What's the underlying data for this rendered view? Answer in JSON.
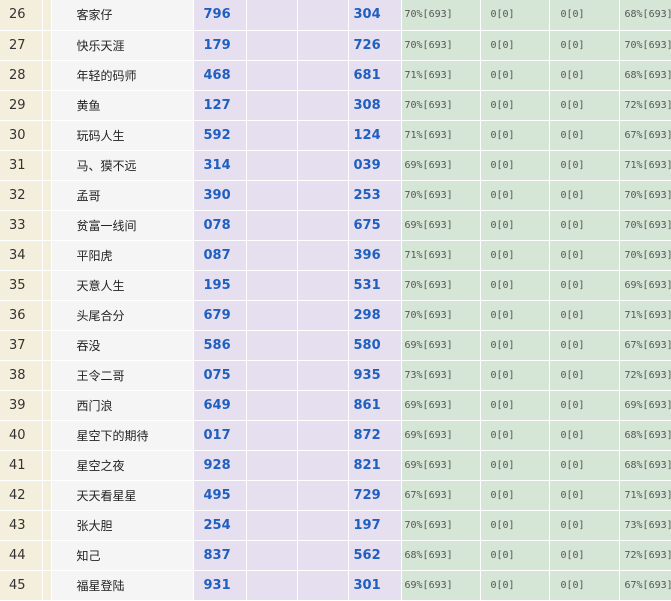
{
  "rows": [
    {
      "rank": "26",
      "name": "客家仔",
      "n1": "796",
      "n2": "304",
      "s1": "70%[693]",
      "s2": "0[0]",
      "s3": "0[0]",
      "s4": "68%[693]"
    },
    {
      "rank": "27",
      "name": "快乐天涯",
      "n1": "179",
      "n2": "726",
      "s1": "70%[693]",
      "s2": "0[0]",
      "s3": "0[0]",
      "s4": "70%[693]"
    },
    {
      "rank": "28",
      "name": "年轻的码师",
      "n1": "468",
      "n2": "681",
      "s1": "71%[693]",
      "s2": "0[0]",
      "s3": "0[0]",
      "s4": "68%[693]"
    },
    {
      "rank": "29",
      "name": "黄鱼",
      "n1": "127",
      "n2": "308",
      "s1": "70%[693]",
      "s2": "0[0]",
      "s3": "0[0]",
      "s4": "72%[693]"
    },
    {
      "rank": "30",
      "name": "玩码人生",
      "n1": "592",
      "n2": "124",
      "s1": "71%[693]",
      "s2": "0[0]",
      "s3": "0[0]",
      "s4": "67%[693]"
    },
    {
      "rank": "31",
      "name": "马、獏不远",
      "n1": "314",
      "n2": "039",
      "s1": "69%[693]",
      "s2": "0[0]",
      "s3": "0[0]",
      "s4": "71%[693]"
    },
    {
      "rank": "32",
      "name": "孟哥",
      "n1": "390",
      "n2": "253",
      "s1": "70%[693]",
      "s2": "0[0]",
      "s3": "0[0]",
      "s4": "70%[693]"
    },
    {
      "rank": "33",
      "name": "贫富一线间",
      "n1": "078",
      "n2": "675",
      "s1": "69%[693]",
      "s2": "0[0]",
      "s3": "0[0]",
      "s4": "70%[693]"
    },
    {
      "rank": "34",
      "name": "平阳虎",
      "n1": "087",
      "n2": "396",
      "s1": "71%[693]",
      "s2": "0[0]",
      "s3": "0[0]",
      "s4": "70%[693]"
    },
    {
      "rank": "35",
      "name": "天意人生",
      "n1": "195",
      "n2": "531",
      "s1": "70%[693]",
      "s2": "0[0]",
      "s3": "0[0]",
      "s4": "69%[693]"
    },
    {
      "rank": "36",
      "name": "头尾合分",
      "n1": "679",
      "n2": "298",
      "s1": "70%[693]",
      "s2": "0[0]",
      "s3": "0[0]",
      "s4": "71%[693]"
    },
    {
      "rank": "37",
      "name": "吞没",
      "n1": "586",
      "n2": "580",
      "s1": "69%[693]",
      "s2": "0[0]",
      "s3": "0[0]",
      "s4": "67%[693]"
    },
    {
      "rank": "38",
      "name": "王令二哥",
      "n1": "075",
      "n2": "935",
      "s1": "73%[693]",
      "s2": "0[0]",
      "s3": "0[0]",
      "s4": "72%[693]"
    },
    {
      "rank": "39",
      "name": "西门浪",
      "n1": "649",
      "n2": "861",
      "s1": "69%[693]",
      "s2": "0[0]",
      "s3": "0[0]",
      "s4": "69%[693]"
    },
    {
      "rank": "40",
      "name": "星空下的期待",
      "n1": "017",
      "n2": "872",
      "s1": "69%[693]",
      "s2": "0[0]",
      "s3": "0[0]",
      "s4": "68%[693]"
    },
    {
      "rank": "41",
      "name": "星空之夜",
      "n1": "928",
      "n2": "821",
      "s1": "69%[693]",
      "s2": "0[0]",
      "s3": "0[0]",
      "s4": "68%[693]"
    },
    {
      "rank": "42",
      "name": "天天看星星",
      "n1": "495",
      "n2": "729",
      "s1": "67%[693]",
      "s2": "0[0]",
      "s3": "0[0]",
      "s4": "71%[693]"
    },
    {
      "rank": "43",
      "name": "张大胆",
      "n1": "254",
      "n2": "197",
      "s1": "70%[693]",
      "s2": "0[0]",
      "s3": "0[0]",
      "s4": "73%[693]"
    },
    {
      "rank": "44",
      "name": "知己",
      "n1": "837",
      "n2": "562",
      "s1": "68%[693]",
      "s2": "0[0]",
      "s3": "0[0]",
      "s4": "72%[693]"
    },
    {
      "rank": "45",
      "name": "福星登陆",
      "n1": "931",
      "n2": "301",
      "s1": "69%[693]",
      "s2": "0[0]",
      "s3": "0[0]",
      "s4": "67%[693]"
    }
  ]
}
